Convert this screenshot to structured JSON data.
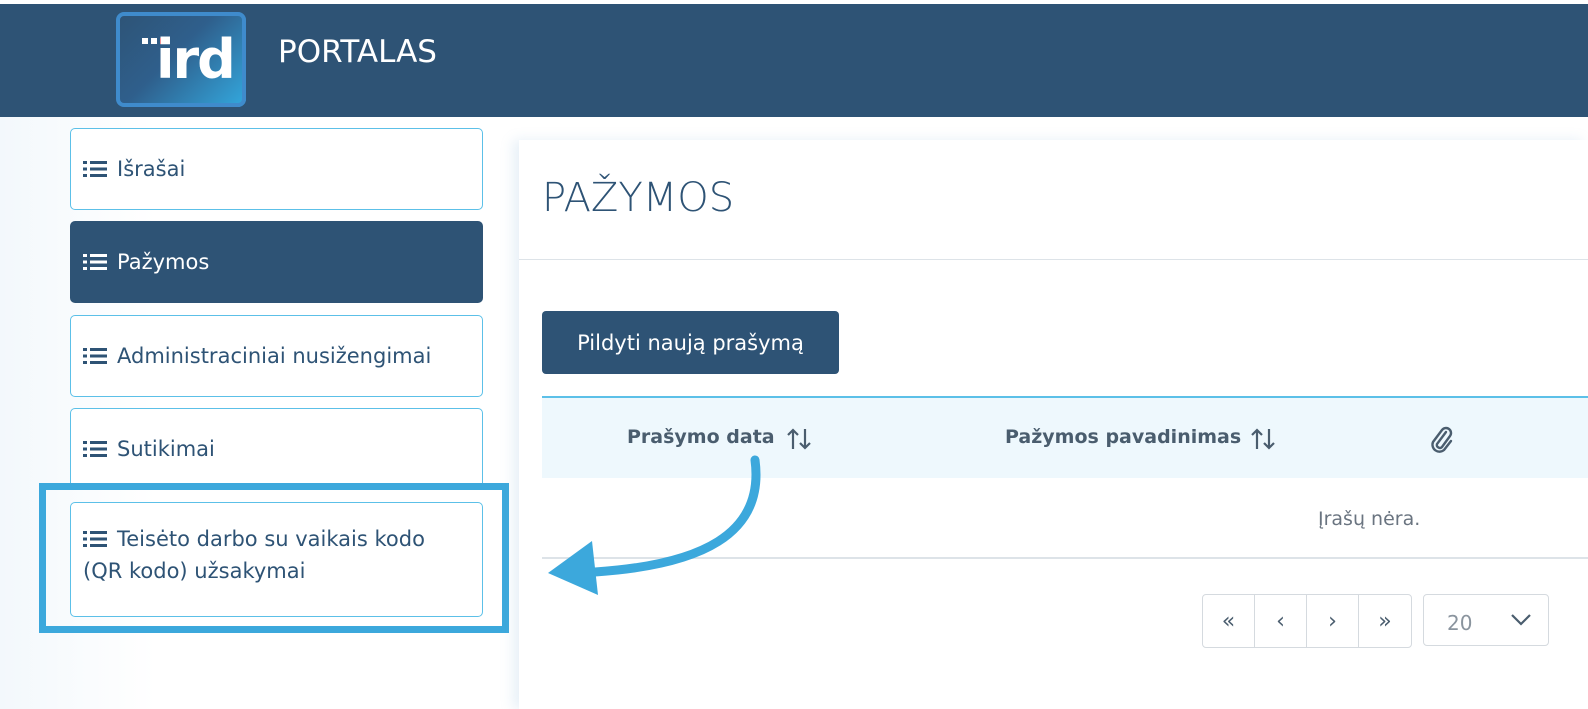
{
  "header": {
    "portal_title": "PORTALAS",
    "logo_text": "ird"
  },
  "sidebar": {
    "items": [
      {
        "label": "Išrašai",
        "icon": "list-icon",
        "active": false
      },
      {
        "label": "Pažymos",
        "icon": "list-icon",
        "active": true
      },
      {
        "label": "Administraciniai nusižengimai",
        "icon": "list-icon",
        "active": false
      },
      {
        "label": "Sutikimai",
        "icon": "list-icon",
        "active": false
      },
      {
        "label_line1": "Teisėto darbo su vaikais kodo",
        "label_line2": "(QR kodo) užsakymai",
        "icon": "list-icon",
        "active": false
      }
    ]
  },
  "main": {
    "title": "PAŽYMOS",
    "new_request_button": "Pildyti naują prašymą",
    "table": {
      "columns": [
        {
          "label": "Prašymo data",
          "sortable": true
        },
        {
          "label": "Pažymos pavadinimas",
          "sortable": true
        },
        {
          "label": "",
          "icon": "paperclip-icon"
        }
      ],
      "empty_text": "Įrašų nėra."
    },
    "pagination": {
      "first": "«",
      "prev": "‹",
      "next": "›",
      "last": "»",
      "page_size": "20"
    }
  },
  "colors": {
    "primary": "#2e5375",
    "accent": "#3ca8dc",
    "header_bg": "#eef8fd"
  }
}
